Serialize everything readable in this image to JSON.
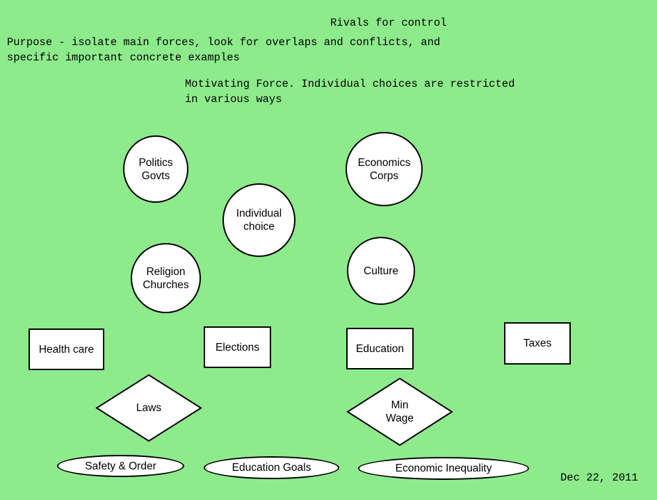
{
  "page": {
    "background_color": "#8deb8c",
    "shape_fill_color": "#ffffff",
    "shape_stroke_color": "#000000",
    "text_color": "#000000"
  },
  "header": {
    "title": "Rivals for control",
    "purpose_line1": "Purpose - isolate main forces, look for overlaps and conflicts, and",
    "purpose_line2": "specific important concrete examples",
    "note_line1": "Motivating Force. Individual choices are restricted",
    "note_line2": "in various ways"
  },
  "diagram": {
    "circles": [
      {
        "id": "politics-govts",
        "line1": "Politics",
        "line2": "Govts"
      },
      {
        "id": "economics-corps",
        "line1": "Economics",
        "line2": "Corps"
      },
      {
        "id": "individual-choice",
        "line1": "Individual",
        "line2": "choice"
      },
      {
        "id": "religion-churches",
        "line1": "Religion",
        "line2": "Churches"
      },
      {
        "id": "culture",
        "line1": "Culture",
        "line2": ""
      }
    ],
    "rectangles": [
      {
        "id": "health-care",
        "label": "Health care"
      },
      {
        "id": "elections",
        "label": "Elections"
      },
      {
        "id": "education",
        "label": "Education"
      },
      {
        "id": "taxes",
        "label": "Taxes"
      }
    ],
    "diamonds": [
      {
        "id": "laws",
        "line1": "Laws",
        "line2": ""
      },
      {
        "id": "min-wage",
        "line1": "Min",
        "line2": "Wage"
      }
    ],
    "ellipses": [
      {
        "id": "safety-order",
        "label": "Safety & Order"
      },
      {
        "id": "education-goals",
        "label": "Education Goals"
      },
      {
        "id": "economic-inequality",
        "label": "Economic Inequality"
      }
    ]
  },
  "footer": {
    "date": "Dec 22, 2011"
  }
}
